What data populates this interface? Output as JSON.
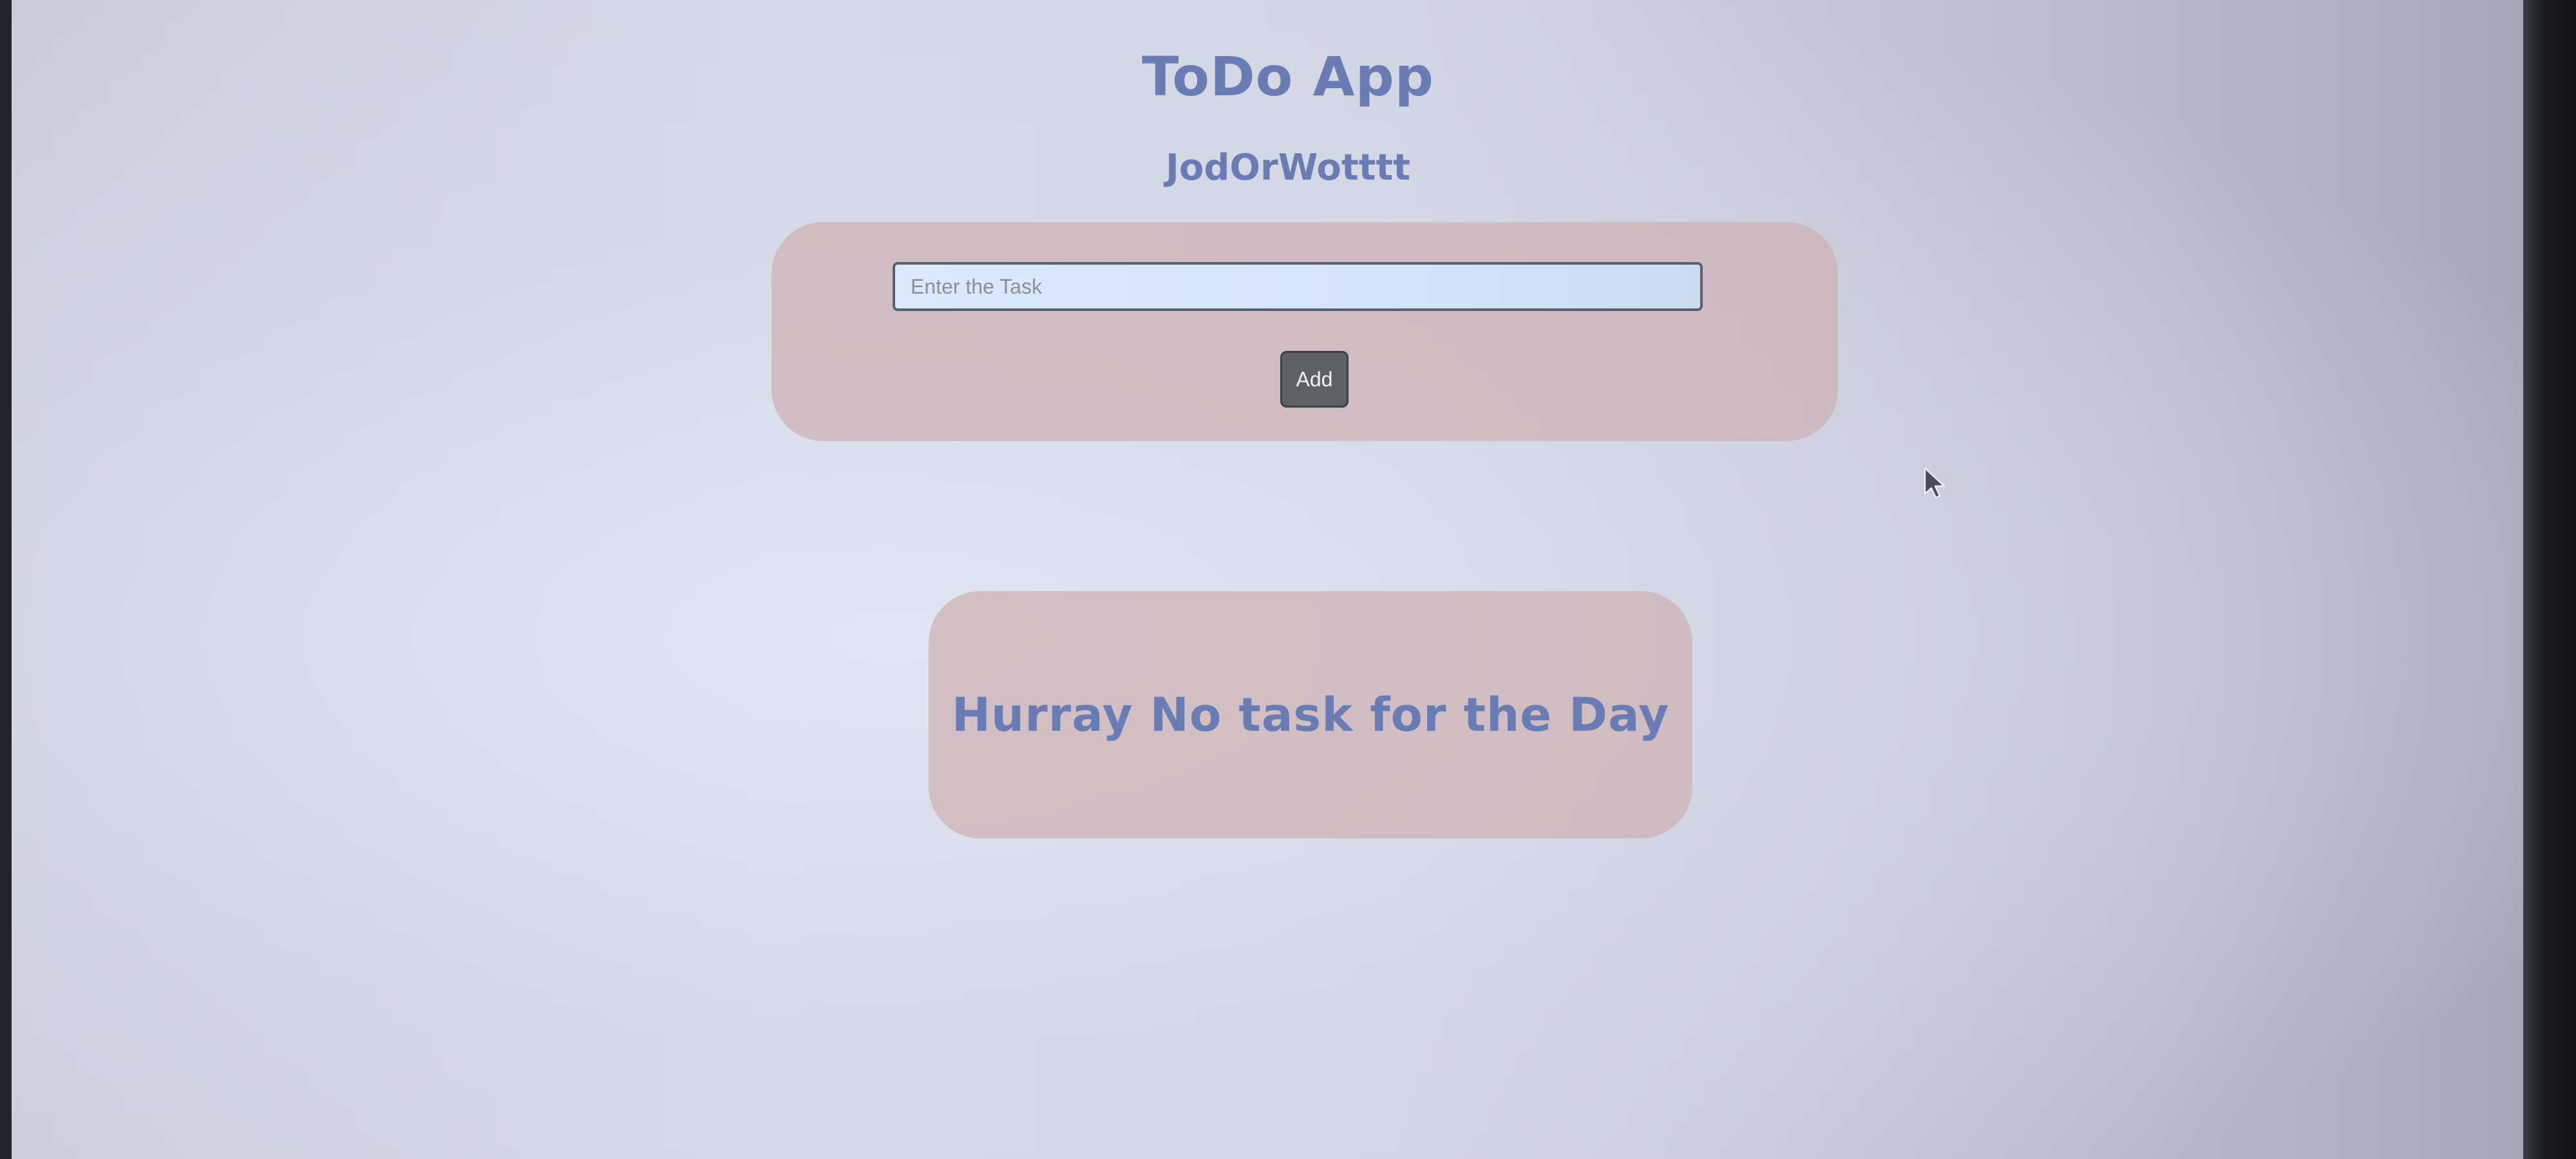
{
  "app": {
    "title": "ToDo App",
    "subtitle": "JodOrWotttt"
  },
  "form": {
    "task_placeholder": "Enter the Task",
    "task_value": "",
    "add_label": "Add"
  },
  "task_list": {
    "empty_message": "Hurray No task for the Day",
    "tasks": []
  },
  "colors": {
    "heading": "#6a7cb4",
    "panel": "#cdb2b4",
    "button": "#5e6068"
  }
}
